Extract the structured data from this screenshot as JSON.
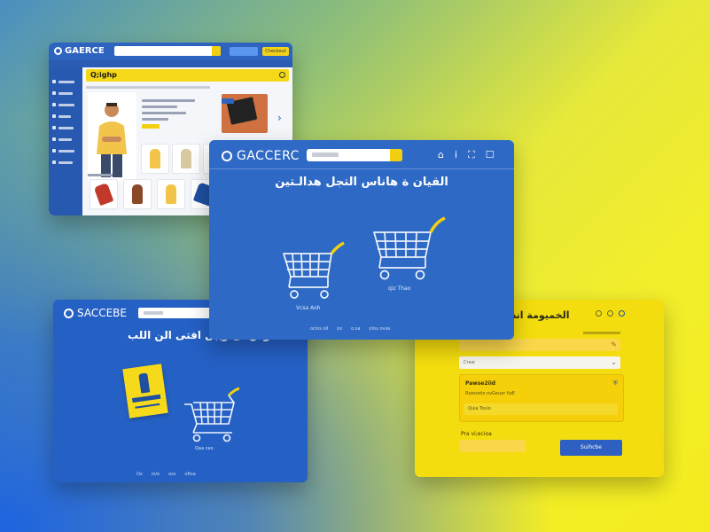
{
  "storefront": {
    "logo": "GAERCE",
    "tb_btn": "Checkout",
    "banner_title": "Q;ighp"
  },
  "cart_hero": {
    "logo": "GACCERC",
    "headline": "القيان ة هاناس التجل هدالـتين",
    "cap1": "Vcsa Aoh",
    "cap2": "qiz Thao",
    "footer": [
      "oclos oll",
      "ox",
      "o.sa",
      "olou ovas"
    ]
  },
  "promo": {
    "logo": "SACCEBE",
    "headline": "اللوس ال ريبل افتى الن اللب",
    "cart_cap": "Qaa cao",
    "footer": [
      "Ox",
      "oi/o",
      "oss",
      "o6oa"
    ]
  },
  "checkout": {
    "title": "الخميومة انة",
    "field2_ph": "Craw",
    "pay_title": "Pawse2iid",
    "pay_sub": "Rsesosto ovGeuor ItzE",
    "pay_field": "Quia Tovio",
    "label": "Pra vi;ecioa",
    "submit": "Suihcbe"
  },
  "icons": {
    "logo": "logo-ring-icon",
    "search": "search-icon",
    "cart": "shopping-cart-icon",
    "lock": "lock-icon",
    "user": "user-icon",
    "shield": "shield-icon",
    "chevron": "chevron-right-icon",
    "card": "credit-card-icon"
  },
  "colors": {
    "brand_blue": "#2e6ac5",
    "brand_yellow": "#f4dd0e",
    "accent_yellow": "#f3cf12"
  }
}
